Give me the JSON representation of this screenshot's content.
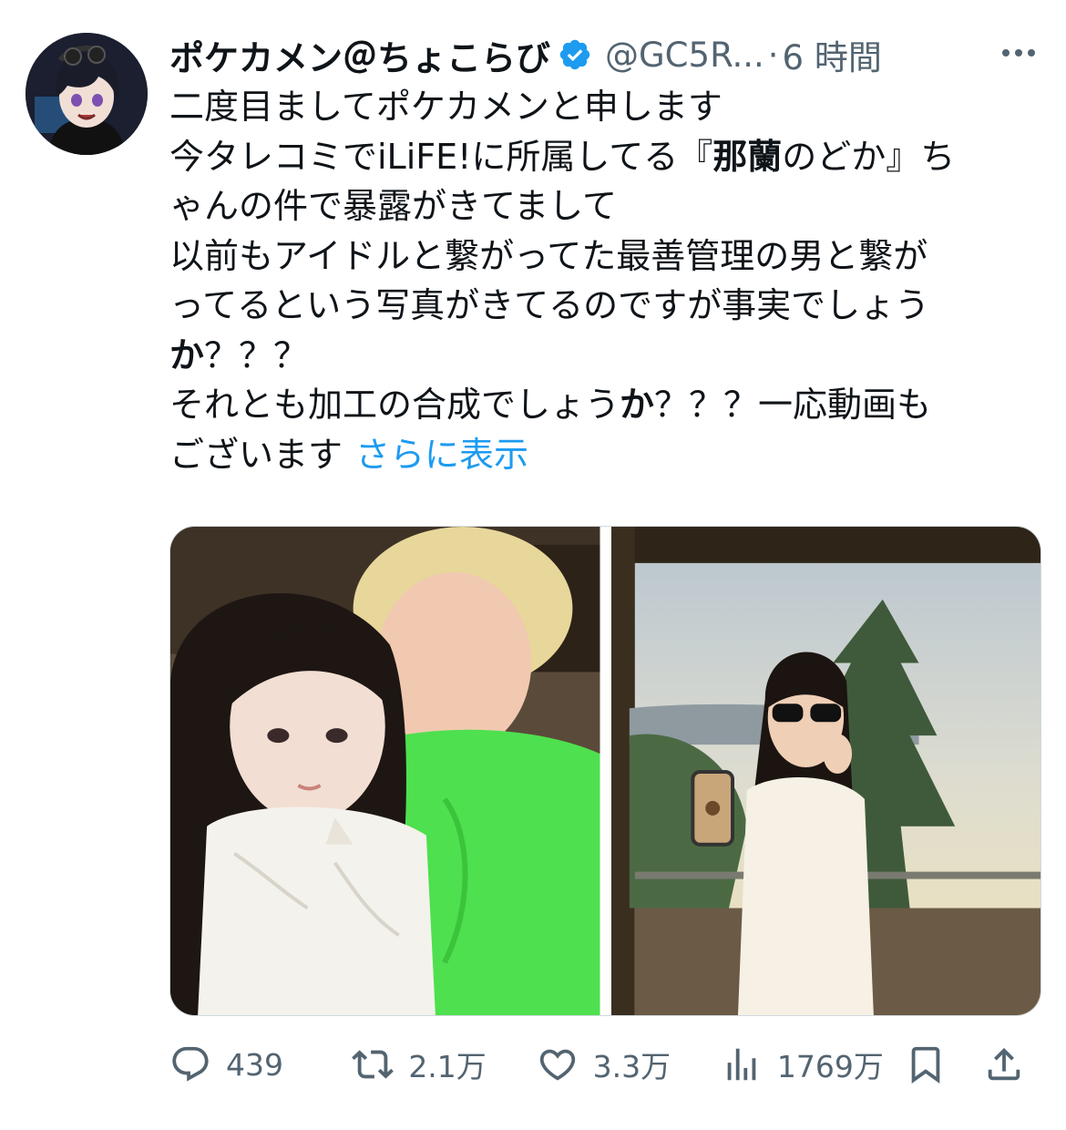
{
  "tweet": {
    "author_name": "ポケカメン＠ちょこらび",
    "handle": "@GC5R...",
    "dot": "·",
    "time": "6 時間",
    "lines": [
      {
        "parts": [
          {
            "t": "二度目ましてポケカメンと申します"
          }
        ]
      },
      {
        "parts": [
          {
            "t": "今タレコミでiLiFE!に所属してる『"
          },
          {
            "t": "那蘭",
            "b": true
          },
          {
            "t": "のどか』ち"
          }
        ]
      },
      {
        "parts": [
          {
            "t": "ゃんの件で暴露がきてまして"
          }
        ]
      },
      {
        "parts": [
          {
            "t": "以前もアイドルと繋がってた最善管理の男と繋が"
          }
        ]
      },
      {
        "parts": [
          {
            "t": "ってるという写真がきてるのですが事実でしょう"
          }
        ]
      },
      {
        "parts": [
          {
            "t": "か",
            "b": true
          },
          {
            "t": "？？？"
          }
        ]
      },
      {
        "parts": [
          {
            "t": "それとも加工の合成でしょう"
          },
          {
            "t": "か",
            "b": true
          },
          {
            "t": "？？？一応動画も"
          }
        ]
      },
      {
        "parts": [
          {
            "t": "ございます"
          }
        ]
      }
    ],
    "show_more": "さらに表示"
  },
  "actions": {
    "replies": "439",
    "retweets": "2.1万",
    "likes": "3.3万",
    "views": "1769万"
  },
  "colors": {
    "accent": "#1d9bf0",
    "secondary_text": "#536471",
    "text": "#0f1419",
    "shirt_green": "#4ee04e"
  },
  "icons": [
    "verified-badge-icon",
    "more-icon",
    "reply-icon",
    "retweet-icon",
    "like-icon",
    "views-icon",
    "bookmark-icon",
    "share-icon"
  ]
}
